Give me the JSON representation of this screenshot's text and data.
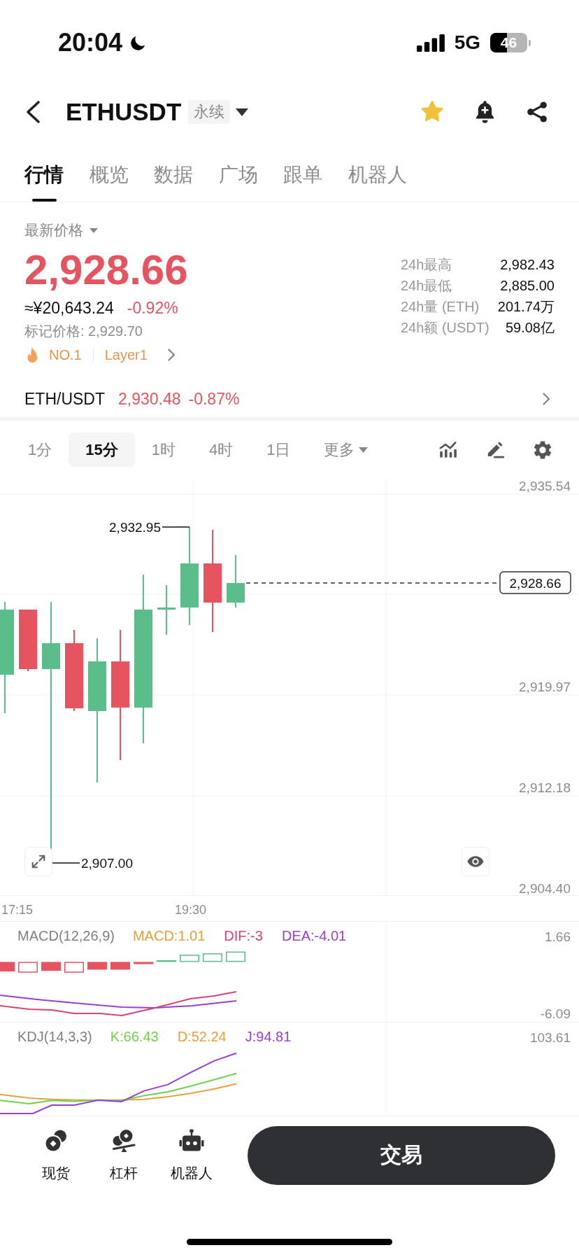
{
  "status_bar": {
    "time": "20:04",
    "network": "5G",
    "battery": "46"
  },
  "header": {
    "symbol": "ETHUSDT",
    "contract_type": "永续",
    "favorite": true
  },
  "tabs": [
    {
      "label": "行情",
      "selected": true
    },
    {
      "label": "概览",
      "selected": false
    },
    {
      "label": "数据",
      "selected": false
    },
    {
      "label": "广场",
      "selected": false
    },
    {
      "label": "跟单",
      "selected": false
    },
    {
      "label": "机器人",
      "selected": false
    }
  ],
  "ticker": {
    "price_label": "最新价格",
    "last_price": "2,928.66",
    "fiat_price": "≈¥20,643.24",
    "change": "-0.92%",
    "mark_price": "标记价格: 2,929.70",
    "rank": "NO.1",
    "sector": "Layer1"
  },
  "stats": [
    {
      "label": "24h最高",
      "value": "2,982.43"
    },
    {
      "label": "24h最低",
      "value": "2,885.00"
    },
    {
      "label": "24h量 (ETH)",
      "value": "201.74万"
    },
    {
      "label": "24h额 (USDT)",
      "value": "59.08亿"
    }
  ],
  "spot": {
    "pair": "ETH/USDT",
    "price": "2,930.48",
    "change": "-0.87%"
  },
  "intervals": [
    {
      "label": "1分",
      "kind": "interval",
      "selected": false
    },
    {
      "label": "15分",
      "kind": "interval",
      "selected": true
    },
    {
      "label": "1时",
      "kind": "interval",
      "selected": false
    },
    {
      "label": "4时",
      "kind": "interval",
      "selected": false
    },
    {
      "label": "1日",
      "kind": "interval",
      "selected": false
    },
    {
      "label": "更多",
      "kind": "dropdown",
      "selected": false
    }
  ],
  "chart": {
    "price_axis": [
      "2,935.54",
      "2,919.97",
      "2,912.18",
      "2,904.40"
    ],
    "high_label": "2,932.95",
    "low_label": "2,907.00",
    "current_price": "2,928.66",
    "time_axis": [
      "17:15",
      "19:30"
    ]
  },
  "macd": {
    "title": "MACD(12,26,9)",
    "values": [
      {
        "text": "MACD:1.01",
        "color": "#e6a23c"
      },
      {
        "text": "DIF:-3",
        "color": "#d4437a"
      },
      {
        "text": "DEA:-4.01",
        "color": "#9a3fd6"
      }
    ],
    "axis": [
      "1.66",
      "-6.09"
    ]
  },
  "kdj": {
    "title": "KDJ(14,3,3)",
    "values": [
      {
        "text": "K:66.43",
        "color": "#6fd24f"
      },
      {
        "text": "D:52.24",
        "color": "#e6a23c"
      },
      {
        "text": "J:94.81",
        "color": "#9a3fd6"
      }
    ],
    "axis": [
      "103.61"
    ]
  },
  "bottom_nav": [
    {
      "label": "现货"
    },
    {
      "label": "杠杆"
    },
    {
      "label": "机器人"
    }
  ],
  "trade_button": "交易"
}
